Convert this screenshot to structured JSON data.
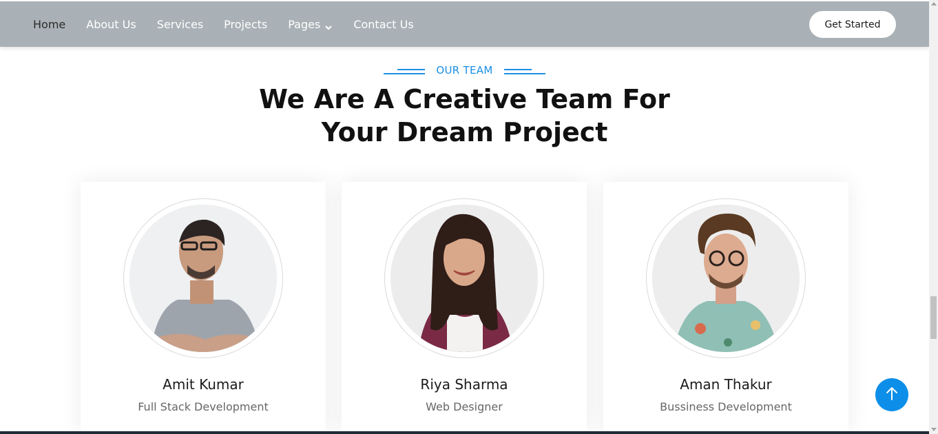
{
  "nav": {
    "items": [
      {
        "label": "Home",
        "active": true
      },
      {
        "label": "About Us"
      },
      {
        "label": "Services"
      },
      {
        "label": "Projects"
      },
      {
        "label": "Pages",
        "has_dropdown": true
      },
      {
        "label": "Contact Us"
      }
    ],
    "cta_label": "Get Started"
  },
  "section": {
    "eyebrow": "OUR TEAM",
    "title_line1": "We Are A Creative Team For",
    "title_line2": "Your Dream Project"
  },
  "team": [
    {
      "name": "Amit Kumar",
      "role": "Full Stack Development"
    },
    {
      "name": "Riya Sharma",
      "role": "Web Designer"
    },
    {
      "name": "Aman Thakur",
      "role": "Bussiness Development"
    }
  ],
  "colors": {
    "accent": "#1a8fe3",
    "nav_bg": "#a9b1b6",
    "button_blue": "#0d8ee8"
  },
  "icons": {
    "dropdown": "chevron-down-icon",
    "back_to_top": "arrow-up-icon"
  }
}
